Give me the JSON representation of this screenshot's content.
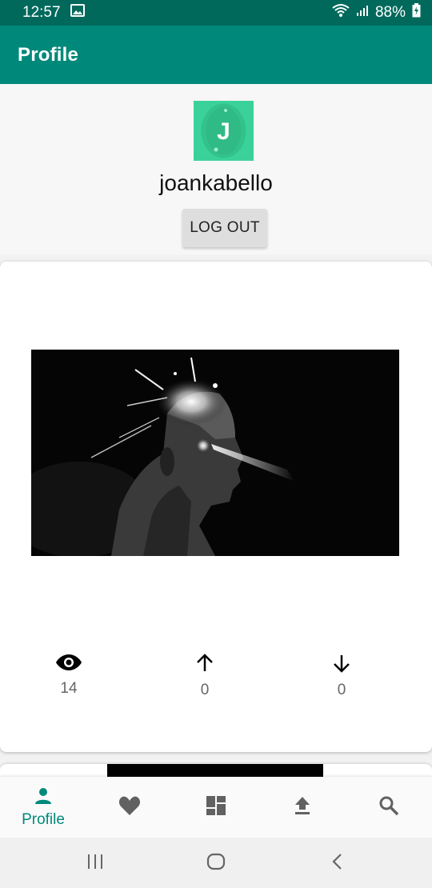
{
  "status_bar": {
    "time": "12:57",
    "battery_percent": "88%",
    "icons": [
      "image-icon",
      "wifi-icon",
      "signal-icon",
      "battery-charging-icon"
    ]
  },
  "app_bar": {
    "title": "Profile"
  },
  "profile": {
    "avatar_letter": "J",
    "username": "joankabello",
    "logout_label": "LOG OUT"
  },
  "post": {
    "image_icon": "cyborg-artwork-image",
    "views": "14",
    "upvotes": "0",
    "downvotes": "0"
  },
  "bottom_nav": {
    "items": [
      {
        "icon": "person-icon",
        "label": "Profile",
        "active": true
      },
      {
        "icon": "heart-icon",
        "label": "",
        "active": false
      },
      {
        "icon": "dashboard-icon",
        "label": "",
        "active": false
      },
      {
        "icon": "upload-icon",
        "label": "",
        "active": false
      },
      {
        "icon": "search-icon",
        "label": "",
        "active": false
      }
    ]
  },
  "colors": {
    "primary": "#00897b",
    "primary_dark": "#00695c",
    "inactive_icon": "#616161"
  }
}
